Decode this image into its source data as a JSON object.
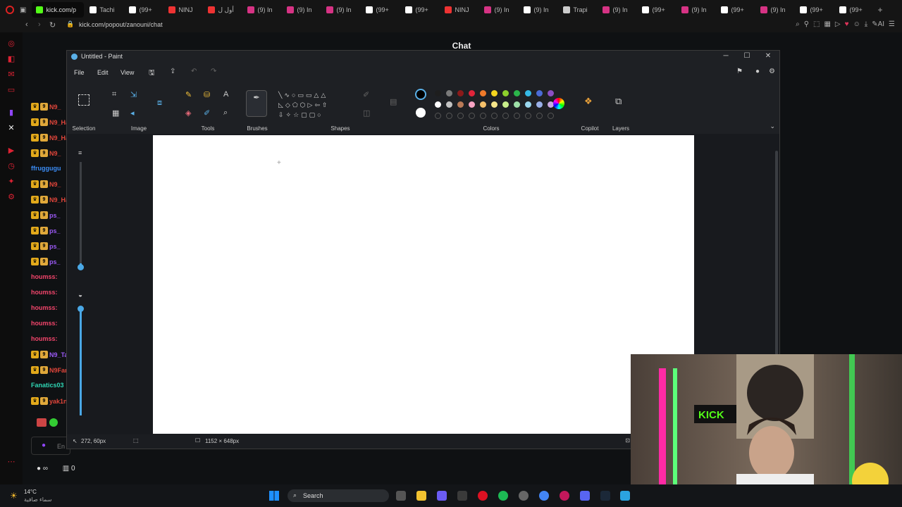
{
  "browser": {
    "tabs": [
      {
        "label": "kick.com/p",
        "active": true,
        "color": "#53fc18"
      },
      {
        "label": "Tachi",
        "color": "#fff"
      },
      {
        "label": "(99+",
        "color": "#fff"
      },
      {
        "label": "NINJ",
        "color": "#e33"
      },
      {
        "label": "أول ل",
        "color": "#e33"
      },
      {
        "label": "(9) In",
        "color": "#d63384"
      },
      {
        "label": "(9) In",
        "color": "#d63384"
      },
      {
        "label": "(9) In",
        "color": "#d63384"
      },
      {
        "label": "(99+",
        "color": "#fff"
      },
      {
        "label": "(99+",
        "color": "#fff"
      },
      {
        "label": "NINJ",
        "color": "#e33"
      },
      {
        "label": "(9) In",
        "color": "#d63384"
      },
      {
        "label": "(9) In",
        "color": "#fff"
      },
      {
        "label": "Trapi",
        "color": "#ccc"
      },
      {
        "label": "(9) In",
        "color": "#d63384"
      },
      {
        "label": "(99+",
        "color": "#fff"
      },
      {
        "label": "(9) In",
        "color": "#d63384"
      },
      {
        "label": "(99+",
        "color": "#fff"
      },
      {
        "label": "(9) In",
        "color": "#d63384"
      },
      {
        "label": "(99+",
        "color": "#fff"
      },
      {
        "label": "(99+",
        "color": "#fff"
      }
    ],
    "url": "kick.com/popout/zanouni/chat"
  },
  "chat": {
    "title": "Chat",
    "lines": [
      {
        "name": "N9_",
        "color": "#e0453a",
        "badge": true
      },
      {
        "name": "N9_Ha",
        "color": "#e0453a",
        "badge": true
      },
      {
        "name": "N9_Ha",
        "color": "#e0453a",
        "badge": true
      },
      {
        "name": "N9_",
        "color": "#e0453a",
        "badge": true
      },
      {
        "name": "ffruggugu",
        "color": "#3b8cf5",
        "badge": false
      },
      {
        "name": "N9_",
        "color": "#e0453a",
        "badge": true
      },
      {
        "name": "N9_Ha",
        "color": "#e0453a",
        "badge": true
      },
      {
        "name": "ps_",
        "color": "#9b59f5",
        "badge": true
      },
      {
        "name": "ps_",
        "color": "#9b59f5",
        "badge": true
      },
      {
        "name": "ps_",
        "color": "#9b59f5",
        "badge": true
      },
      {
        "name": "ps_",
        "color": "#9b59f5",
        "badge": true
      },
      {
        "name": "houmss:",
        "color": "#f2456b",
        "badge": false
      },
      {
        "name": "houmss:",
        "color": "#f2456b",
        "badge": false
      },
      {
        "name": "houmss:",
        "color": "#f2456b",
        "badge": false
      },
      {
        "name": "houmss:",
        "color": "#f2456b",
        "badge": false
      },
      {
        "name": "houmss:",
        "color": "#f2456b",
        "badge": false
      },
      {
        "name": "N9_Tan",
        "color": "#9b59f5",
        "badge": true
      },
      {
        "name": "N9Fan",
        "color": "#e0453a",
        "badge": true
      },
      {
        "name": "Fanatics03",
        "color": "#2fd6b4",
        "badge": false
      },
      {
        "name": "yak1n3",
        "color": "#e0453a",
        "badge": true
      }
    ],
    "input_placeholder": "En",
    "footer_count": "0"
  },
  "paint": {
    "window_title": "Untitled - Paint",
    "menu": [
      "File",
      "Edit",
      "View"
    ],
    "groups": {
      "selection": "Selection",
      "image": "Image",
      "tools": "Tools",
      "brushes": "Brushes",
      "shapes": "Shapes",
      "colors": "Colors",
      "copilot": "Copilot",
      "layers": "Layers"
    },
    "palette_row1": [
      "#1e1e1e",
      "#7a7a7a",
      "#8b1a1a",
      "#e0243a",
      "#f07a2a",
      "#f5d51e",
      "#8dd02c",
      "#2bb54a",
      "#35b9e6",
      "#4a6bd6",
      "#8a4fc4"
    ],
    "palette_row2": [
      "#ffffff",
      "#c3c3c3",
      "#b97a57",
      "#f6a3c3",
      "#f5c06a",
      "#f6e58a",
      "#c8ee8a",
      "#9ee0a8",
      "#9ad7ee",
      "#9ab0e8",
      "#c8a8e0"
    ],
    "status": {
      "cursor_pos": "272, 60px",
      "canvas_size": "1152 × 648px"
    }
  },
  "taskbar": {
    "weather_temp": "14°C",
    "weather_desc": "سماء صافية",
    "search_label": "Search"
  }
}
